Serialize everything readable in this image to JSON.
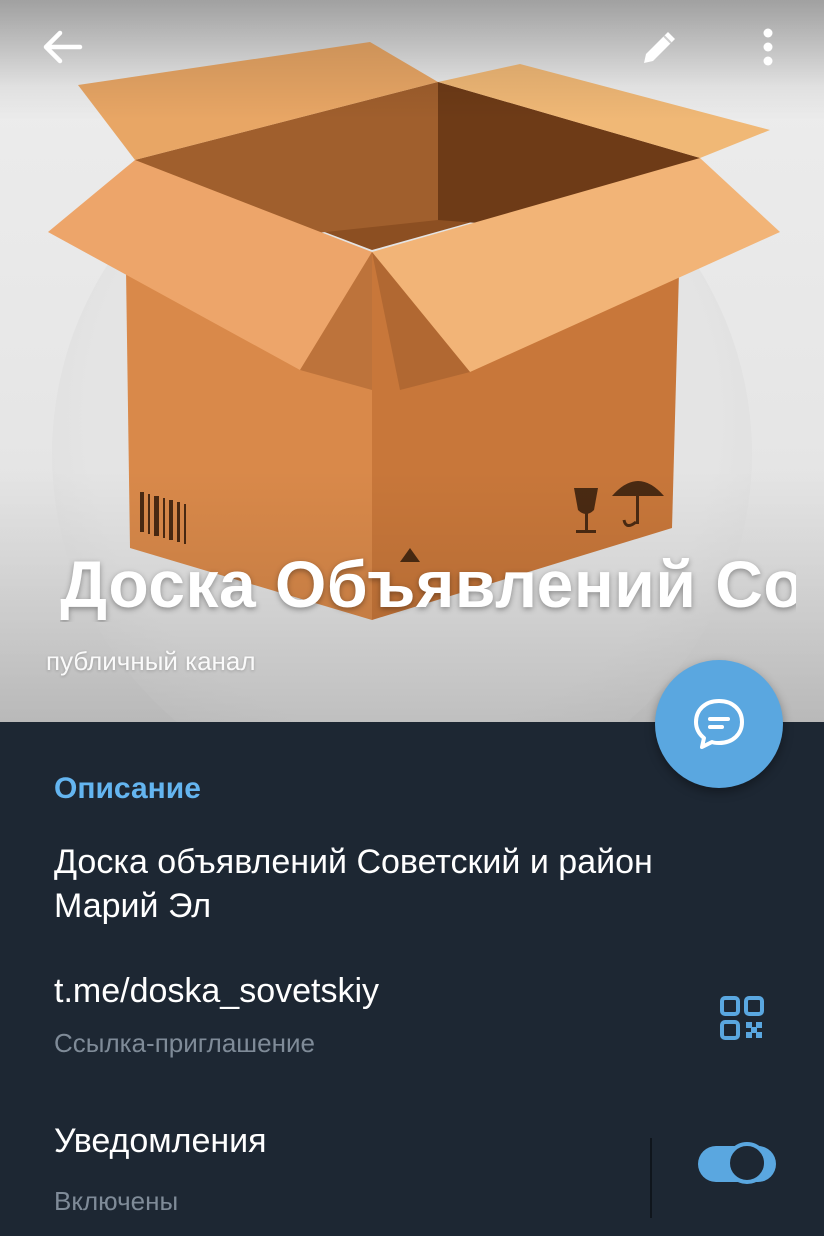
{
  "header": {
    "title": "Доска Объявлений Со",
    "subtitle": "публичный канал",
    "back_icon": "arrow-left-icon",
    "edit_icon": "pencil-icon",
    "more_icon": "more-vertical-icon",
    "avatar": "cardboard-box-image",
    "fab_icon": "chat-bubble-icon"
  },
  "info": {
    "section_title": "Описание",
    "description": "Доска объявлений Советский и район Марий Эл",
    "link": {
      "value": "t.me/doska_sovetskiy",
      "caption": "Ссылка-приглашение",
      "icon": "qr-code-icon"
    },
    "notifications": {
      "title": "Уведомления",
      "caption": "Включены",
      "enabled": true
    }
  },
  "colors": {
    "background": "#1d2733",
    "accent": "#5aa7e0",
    "section_title": "#64b5f0",
    "secondary_text": "#7f8b98"
  }
}
